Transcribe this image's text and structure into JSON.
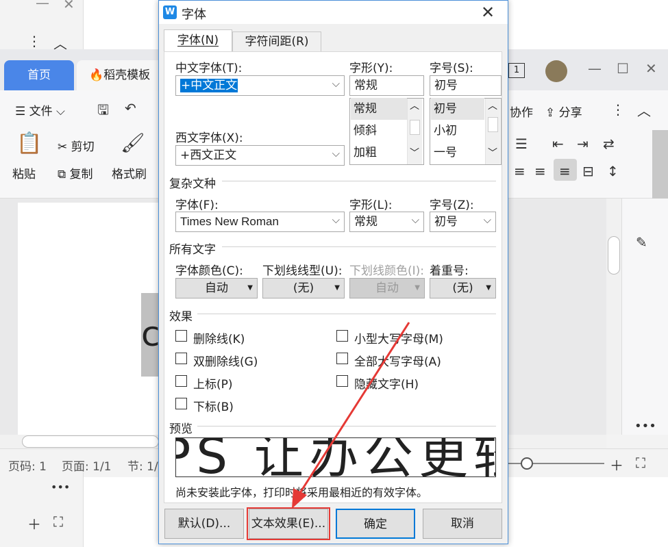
{
  "background": {
    "tabs": {
      "home": "首页",
      "template": "稻壳模板"
    },
    "ribbon": {
      "file": "文件",
      "cut": "剪切",
      "paste": "粘贴",
      "copy": "复制",
      "format_painter": "格式刷",
      "collab": "协作",
      "share": "分享"
    },
    "page_letter": "c",
    "status": {
      "page_no": "页码: 1",
      "pages": "页面: 1/1",
      "section": "节: 1/"
    },
    "colors": {
      "accent": "#4a86e8"
    }
  },
  "dialog": {
    "title": "字体",
    "tabs": [
      "字体(N)",
      "字符间距(R)"
    ],
    "cn_font_label": "中文字体(T):",
    "cn_font_value": "+中文正文",
    "style_label": "字形(Y):",
    "style_value": "常规",
    "style_list": [
      "常规",
      "倾斜",
      "加粗"
    ],
    "size_label": "字号(S):",
    "size_value": "初号",
    "size_list": [
      "初号",
      "小初",
      "一号"
    ],
    "west_font_label": "西文字体(X):",
    "west_font_value": "+西文正文",
    "complex_section": "复杂文种",
    "complex_font_label": "字体(F):",
    "complex_font_value": "Times New Roman",
    "complex_style_label": "字形(L):",
    "complex_style_value": "常规",
    "complex_size_label": "字号(Z):",
    "complex_size_value": "初号",
    "all_text_section": "所有文字",
    "color_label": "字体颜色(C):",
    "color_value": "自动",
    "underline_label": "下划线线型(U):",
    "underline_value": "(无)",
    "underline_color_label": "下划线颜色(I):",
    "underline_color_value": "自动",
    "emphasis_label": "着重号:",
    "emphasis_value": "(无)",
    "effects_section": "效果",
    "effects_left": [
      "删除线(K)",
      "双删除线(G)",
      "上标(P)",
      "下标(B)"
    ],
    "effects_right": [
      "小型大写字母(M)",
      "全部大写字母(A)",
      "隐藏文字(H)"
    ],
    "preview_section": "预览",
    "preview_text": "PS 让办公更轻",
    "preview_note": "尚未安装此字体，打印时将采用最相近的有效字体。",
    "buttons": {
      "default": "默认(D)...",
      "text_effect": "文本效果(E)...",
      "ok": "确定",
      "cancel": "取消"
    },
    "colors": {
      "highlight": "#0078d7",
      "annotation": "#e53935",
      "title_border": "#4a8fd8"
    }
  }
}
